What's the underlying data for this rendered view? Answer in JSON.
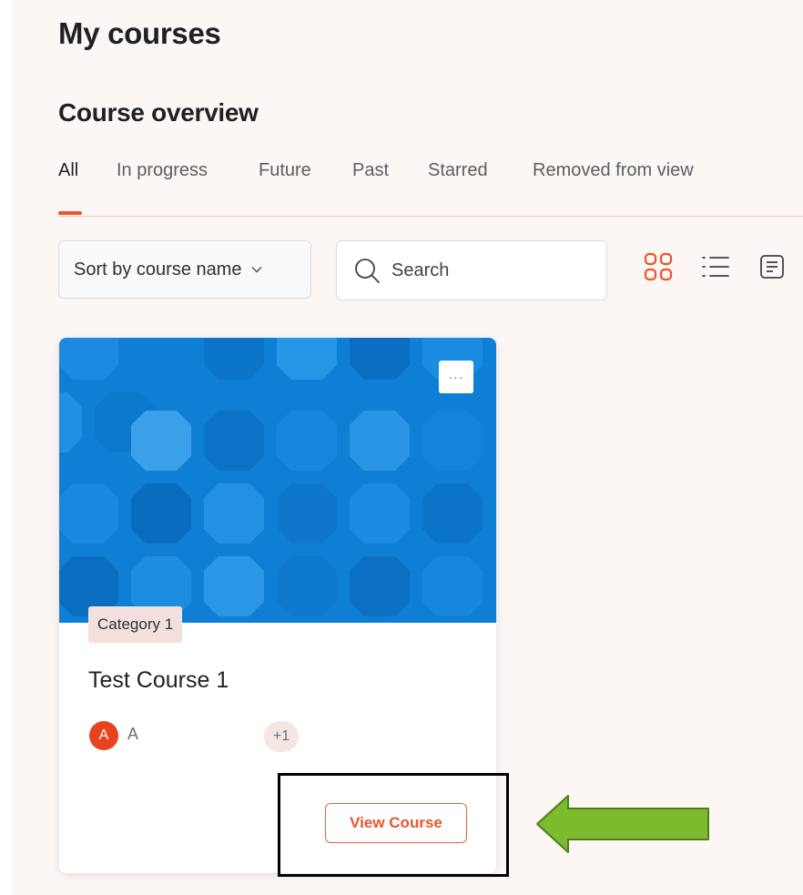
{
  "page": {
    "title": "My courses"
  },
  "overview": {
    "title": "Course overview",
    "tabs": [
      {
        "label": "All",
        "active": true
      },
      {
        "label": "In progress",
        "active": false
      },
      {
        "label": "Future",
        "active": false
      },
      {
        "label": "Past",
        "active": false
      },
      {
        "label": "Starred",
        "active": false
      },
      {
        "label": "Removed from view",
        "active": false
      }
    ]
  },
  "toolbar": {
    "sort_label": "Sort by course name",
    "search_placeholder": "Search",
    "view_icons": [
      "grid-view-icon",
      "list-view-icon",
      "summary-view-icon"
    ]
  },
  "course": {
    "category": "Category 1",
    "title": "Test Course 1",
    "teacher_initial": "A",
    "teacher_name_visible": "A",
    "more_teachers": "+1",
    "menu_label": "···",
    "button_label": "View Course"
  },
  "colors": {
    "accent": "#e8562a",
    "card_image": "#0f7fd6",
    "page_background": "#fcf6f5",
    "callout_arrow": "#7cba2e"
  }
}
